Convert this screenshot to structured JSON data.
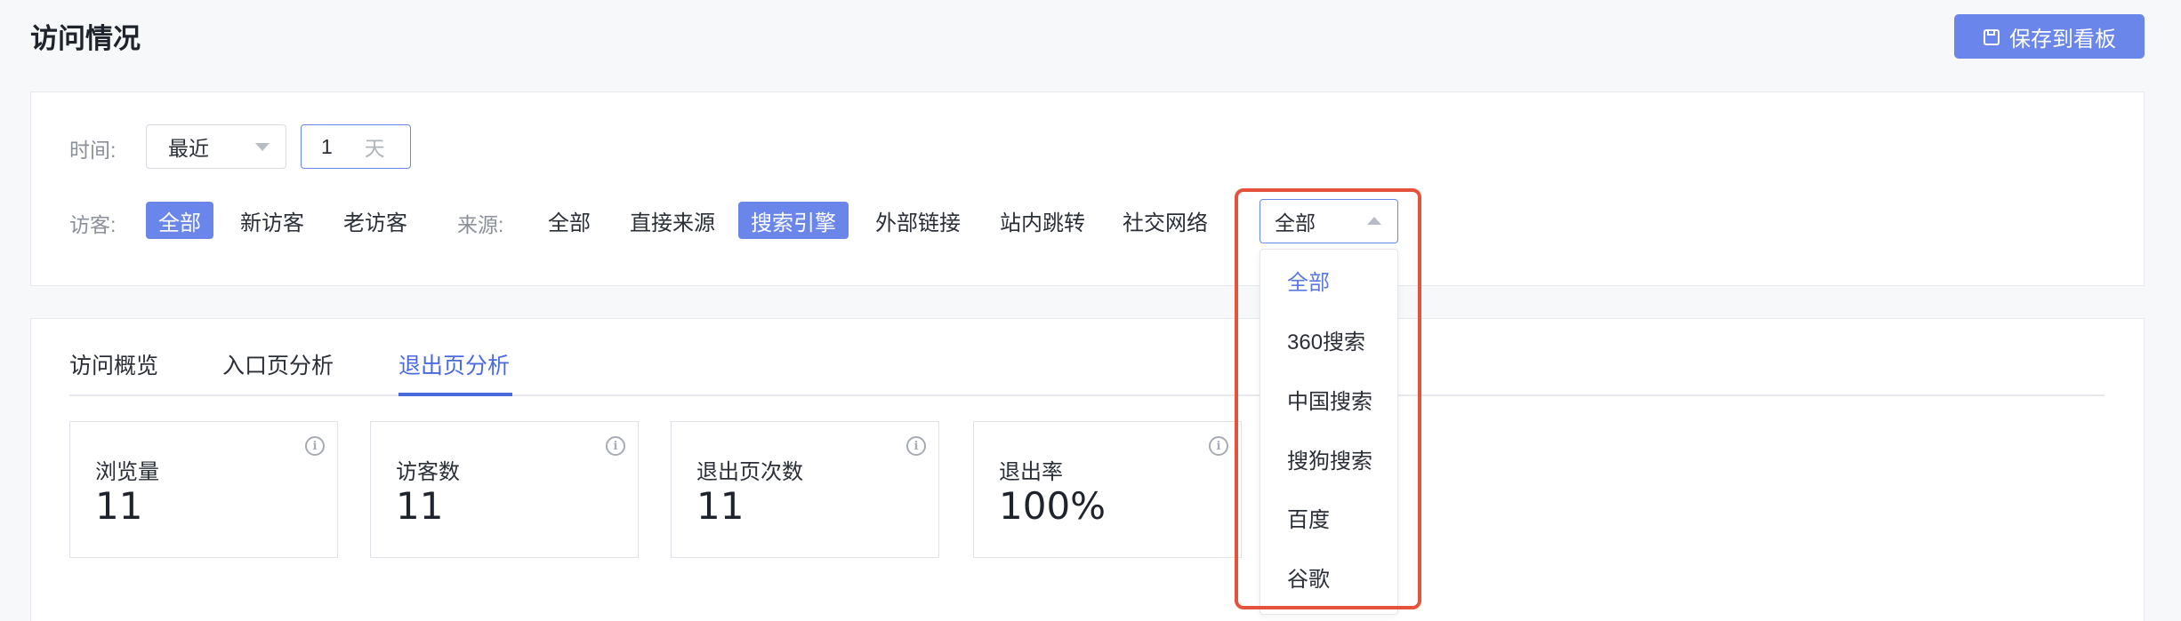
{
  "page": {
    "title": "访问情况"
  },
  "header": {
    "save_label": "保存到看板"
  },
  "filters": {
    "time_label": "时间:",
    "time_range_value": "最近",
    "days_value": "1",
    "days_unit": "天",
    "visitor_label": "访客:",
    "visitor_options": [
      "全部",
      "新访客",
      "老访客"
    ],
    "visitor_active": "全部",
    "source_label": "来源:",
    "source_options": [
      "全部",
      "直接来源",
      "搜索引擎",
      "外部链接",
      "站内跳转",
      "社交网络"
    ],
    "source_active": "搜索引擎",
    "engine_select_value": "全部",
    "engine_options": [
      "全部",
      "360搜索",
      "中国搜索",
      "搜狗搜索",
      "百度",
      "谷歌"
    ],
    "engine_selected": "全部"
  },
  "tabs": [
    {
      "label": "访问概览"
    },
    {
      "label": "入口页分析"
    },
    {
      "label": "退出页分析"
    }
  ],
  "active_tab": "退出页分析",
  "stats": [
    {
      "label": "浏览量",
      "value": "11"
    },
    {
      "label": "访客数",
      "value": "11"
    },
    {
      "label": "退出页次数",
      "value": "11"
    },
    {
      "label": "退出率",
      "value": "100%"
    }
  ],
  "colors": {
    "accent": "#6a86ea",
    "highlight": "#e5533c"
  }
}
